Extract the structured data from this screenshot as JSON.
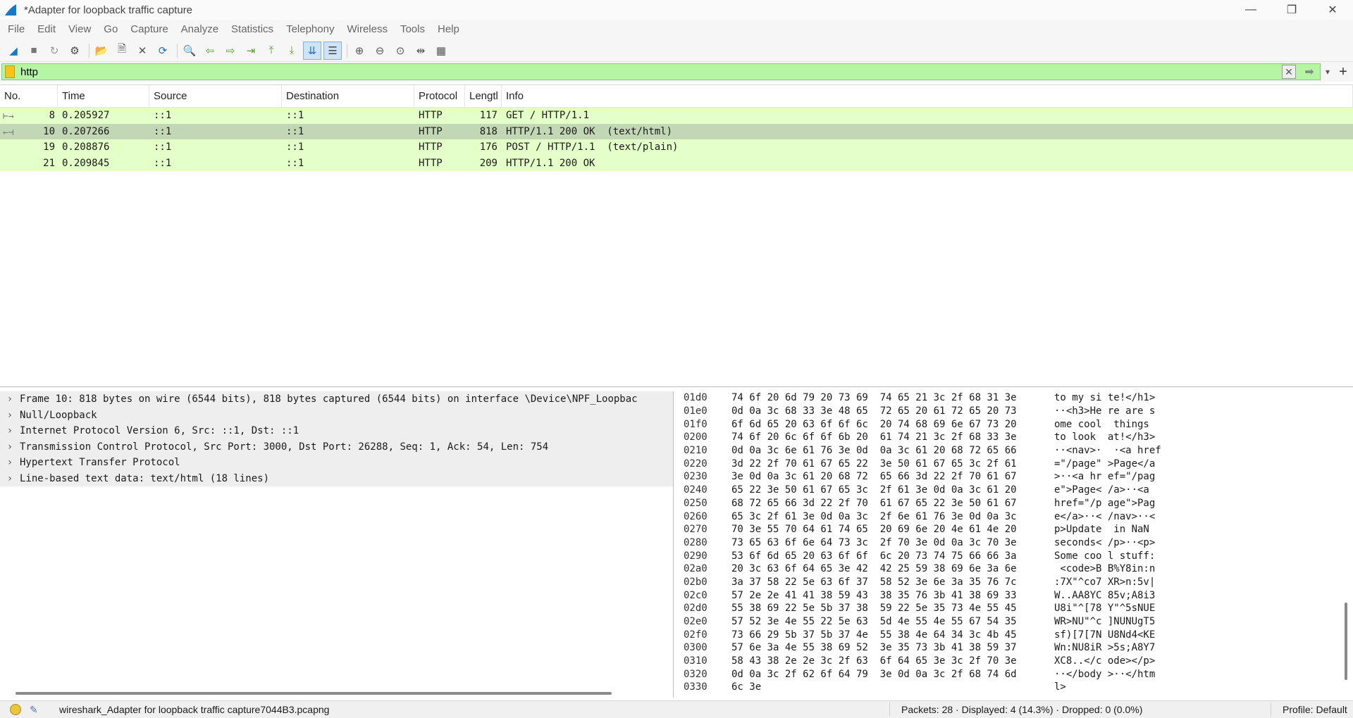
{
  "window": {
    "title": "*Adapter for loopback traffic capture",
    "controls": [
      "—",
      "❐",
      "✕"
    ]
  },
  "menu": [
    "File",
    "Edit",
    "View",
    "Go",
    "Capture",
    "Analyze",
    "Statistics",
    "Telephony",
    "Wireless",
    "Tools",
    "Help"
  ],
  "toolbar": {
    "buttons": [
      {
        "icon": "shark-fin-start-icon",
        "glyph": "◢"
      },
      {
        "icon": "stop-capture-icon",
        "glyph": "■"
      },
      {
        "icon": "restart-capture-icon",
        "glyph": "↻"
      },
      {
        "icon": "capture-options-icon",
        "glyph": "⚙"
      },
      {
        "icon": "open-file-icon",
        "glyph": "📂"
      },
      {
        "icon": "save-file-icon",
        "glyph": "🗎"
      },
      {
        "icon": "close-file-icon",
        "glyph": "✕"
      },
      {
        "icon": "reload-file-icon",
        "glyph": "⟳"
      },
      {
        "icon": "find-packet-icon",
        "glyph": "🔍"
      },
      {
        "icon": "go-back-icon",
        "glyph": "⇦"
      },
      {
        "icon": "go-forward-icon",
        "glyph": "⇨"
      },
      {
        "icon": "go-to-packet-icon",
        "glyph": "⇥"
      },
      {
        "icon": "first-packet-icon",
        "glyph": "⤒"
      },
      {
        "icon": "last-packet-icon",
        "glyph": "⤓"
      },
      {
        "icon": "autoscroll-icon",
        "glyph": "⇊"
      },
      {
        "icon": "colorize-icon",
        "glyph": "☰"
      },
      {
        "icon": "zoom-in-icon",
        "glyph": "⊕"
      },
      {
        "icon": "zoom-out-icon",
        "glyph": "⊖"
      },
      {
        "icon": "normal-size-icon",
        "glyph": "⊙"
      },
      {
        "icon": "resize-columns-icon",
        "glyph": "⇹"
      },
      {
        "icon": "layout-icon",
        "glyph": "▦"
      }
    ]
  },
  "filter": {
    "value": "http",
    "clear_glyph": "✕",
    "apply_glyph": "➡",
    "dropdown_glyph": "▾",
    "add_glyph": "+"
  },
  "packet_list": {
    "columns": [
      "No.",
      "Time",
      "Source",
      "Destination",
      "Protocol",
      "Lengtl",
      "Info"
    ],
    "rows": [
      {
        "no": "8",
        "time": "0.205927",
        "src": "::1",
        "dst": "::1",
        "proto": "HTTP",
        "len": "117",
        "info": "GET / HTTP/1.1",
        "mark": "⊢→",
        "selected": false
      },
      {
        "no": "10",
        "time": "0.207266",
        "src": "::1",
        "dst": "::1",
        "proto": "HTTP",
        "len": "818",
        "info": "HTTP/1.1 200 OK  (text/html)",
        "mark": "←⊣",
        "selected": true
      },
      {
        "no": "19",
        "time": "0.208876",
        "src": "::1",
        "dst": "::1",
        "proto": "HTTP",
        "len": "176",
        "info": "POST / HTTP/1.1  (text/plain)",
        "mark": "",
        "selected": false
      },
      {
        "no": "21",
        "time": "0.209845",
        "src": "::1",
        "dst": "::1",
        "proto": "HTTP",
        "len": "209",
        "info": "HTTP/1.1 200 OK",
        "mark": "",
        "selected": false
      }
    ]
  },
  "details": [
    "Frame 10: 818 bytes on wire (6544 bits), 818 bytes captured (6544 bits) on interface \\Device\\NPF_Loopbac",
    "Null/Loopback",
    "Internet Protocol Version 6, Src: ::1, Dst: ::1",
    "Transmission Control Protocol, Src Port: 3000, Dst Port: 26288, Seq: 1, Ack: 54, Len: 754",
    "Hypertext Transfer Protocol",
    "Line-based text data: text/html (18 lines)"
  ],
  "hex": [
    {
      "off": "01d0",
      "bytes": "74 6f 20 6d 79 20 73 69  74 65 21 3c 2f 68 31 3e",
      "ascii": "to my si te!</h1>"
    },
    {
      "off": "01e0",
      "bytes": "0d 0a 3c 68 33 3e 48 65  72 65 20 61 72 65 20 73",
      "ascii": "··<h3>He re are s"
    },
    {
      "off": "01f0",
      "bytes": "6f 6d 65 20 63 6f 6f 6c  20 74 68 69 6e 67 73 20",
      "ascii": "ome cool  things "
    },
    {
      "off": "0200",
      "bytes": "74 6f 20 6c 6f 6f 6b 20  61 74 21 3c 2f 68 33 3e",
      "ascii": "to look  at!</h3>"
    },
    {
      "off": "0210",
      "bytes": "0d 0a 3c 6e 61 76 3e 0d  0a 3c 61 20 68 72 65 66",
      "ascii": "··<nav>·  ·<a href"
    },
    {
      "off": "0220",
      "bytes": "3d 22 2f 70 61 67 65 22  3e 50 61 67 65 3c 2f 61",
      "ascii": "=\"/page\" >Page</a"
    },
    {
      "off": "0230",
      "bytes": "3e 0d 0a 3c 61 20 68 72  65 66 3d 22 2f 70 61 67",
      "ascii": ">··<a hr ef=\"/pag"
    },
    {
      "off": "0240",
      "bytes": "65 22 3e 50 61 67 65 3c  2f 61 3e 0d 0a 3c 61 20",
      "ascii": "e\">Page< /a>··<a "
    },
    {
      "off": "0250",
      "bytes": "68 72 65 66 3d 22 2f 70  61 67 65 22 3e 50 61 67",
      "ascii": "href=\"/p age\">Pag"
    },
    {
      "off": "0260",
      "bytes": "65 3c 2f 61 3e 0d 0a 3c  2f 6e 61 76 3e 0d 0a 3c",
      "ascii": "e</a>··< /nav>··<"
    },
    {
      "off": "0270",
      "bytes": "70 3e 55 70 64 61 74 65  20 69 6e 20 4e 61 4e 20",
      "ascii": "p>Update  in NaN "
    },
    {
      "off": "0280",
      "bytes": "73 65 63 6f 6e 64 73 3c  2f 70 3e 0d 0a 3c 70 3e",
      "ascii": "seconds< /p>··<p>"
    },
    {
      "off": "0290",
      "bytes": "53 6f 6d 65 20 63 6f 6f  6c 20 73 74 75 66 66 3a",
      "ascii": "Some coo l stuff:"
    },
    {
      "off": "02a0",
      "bytes": "20 3c 63 6f 64 65 3e 42  42 25 59 38 69 6e 3a 6e",
      "ascii": " <code>B B%Y8in:n"
    },
    {
      "off": "02b0",
      "bytes": "3a 37 58 22 5e 63 6f 37  58 52 3e 6e 3a 35 76 7c",
      "ascii": ":7X\"^co7 XR>n:5v|"
    },
    {
      "off": "02c0",
      "bytes": "57 2e 2e 41 41 38 59 43  38 35 76 3b 41 38 69 33",
      "ascii": "W..AA8YC 85v;A8i3"
    },
    {
      "off": "02d0",
      "bytes": "55 38 69 22 5e 5b 37 38  59 22 5e 35 73 4e 55 45",
      "ascii": "U8i\"^[78 Y\"^5sNUE"
    },
    {
      "off": "02e0",
      "bytes": "57 52 3e 4e 55 22 5e 63  5d 4e 55 4e 55 67 54 35",
      "ascii": "WR>NU\"^c ]NUNUgT5"
    },
    {
      "off": "02f0",
      "bytes": "73 66 29 5b 37 5b 37 4e  55 38 4e 64 34 3c 4b 45",
      "ascii": "sf)[7[7N U8Nd4<KE"
    },
    {
      "off": "0300",
      "bytes": "57 6e 3a 4e 55 38 69 52  3e 35 73 3b 41 38 59 37",
      "ascii": "Wn:NU8iR >5s;A8Y7"
    },
    {
      "off": "0310",
      "bytes": "58 43 38 2e 2e 3c 2f 63  6f 64 65 3e 3c 2f 70 3e",
      "ascii": "XC8..</c ode></p>"
    },
    {
      "off": "0320",
      "bytes": "0d 0a 3c 2f 62 6f 64 79  3e 0d 0a 3c 2f 68 74 6d",
      "ascii": "··</body >··</htm"
    },
    {
      "off": "0330",
      "bytes": "6c 3e",
      "ascii": "l>"
    }
  ],
  "status": {
    "file": "wireshark_Adapter for loopback traffic capture7044B3.pcapng",
    "packets": "Packets: 28 · Displayed: 4 (14.3%) · Dropped: 0 (0.0%)",
    "profile": "Profile: Default"
  }
}
